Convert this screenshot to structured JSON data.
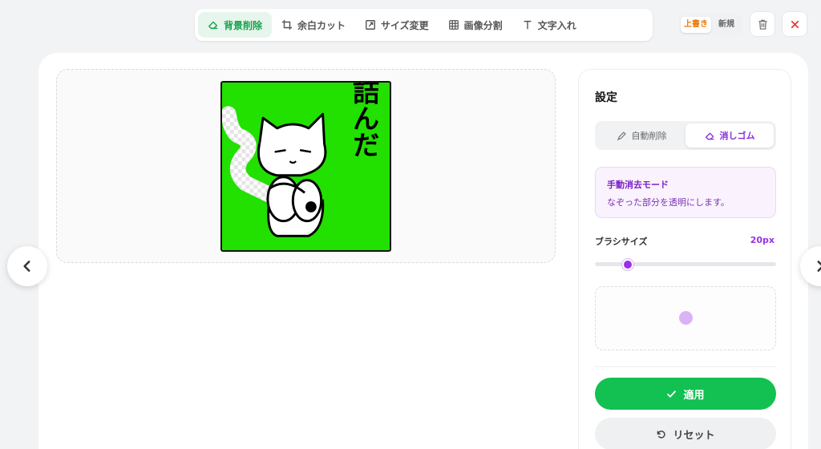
{
  "toolbar": {
    "tabs": [
      {
        "label": "背景削除",
        "icon": "eraser-icon",
        "active": true
      },
      {
        "label": "余白カット",
        "icon": "crop-icon",
        "active": false
      },
      {
        "label": "サイズ変更",
        "icon": "resize-icon",
        "active": false
      },
      {
        "label": "画像分割",
        "icon": "grid-icon",
        "active": false
      },
      {
        "label": "文字入れ",
        "icon": "text-icon",
        "active": false
      }
    ]
  },
  "save_mode": {
    "overwrite": "上書き",
    "new": "新規",
    "selected": "上書き"
  },
  "actions": {
    "delete_icon": "trash-icon",
    "close_icon": "close-icon"
  },
  "image": {
    "caption": "詰んだ"
  },
  "settings": {
    "title": "設定",
    "modes": [
      {
        "label": "自動削除",
        "icon": "pen-icon",
        "active": false
      },
      {
        "label": "消しゴム",
        "icon": "eraser-icon",
        "active": true
      }
    ],
    "info": {
      "title": "手動消去モード",
      "description": "なぞった部分を透明にします。"
    },
    "brush": {
      "label": "ブラシサイズ",
      "value": "20px",
      "level": 0.18
    },
    "apply_label": "適用",
    "reset_label": "リセット"
  },
  "colors": {
    "accent_green": "#12c151",
    "accent_purple": "#9b30e8",
    "stamp_background": "#22e000",
    "overwrite_orange": "#ea7a0c"
  }
}
